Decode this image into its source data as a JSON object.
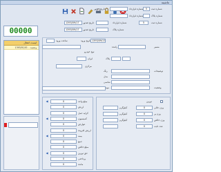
{
  "window": {
    "title": "ماشینه"
  },
  "toolbar": {
    "buttons": [
      {
        "name": "save-icon",
        "color": "#2d5fb0"
      },
      {
        "name": "delete-x-icon",
        "color": "#c0392b"
      },
      {
        "name": "new-document-icon",
        "color": "#3c7a3c"
      },
      {
        "name": "edit-pencil-icon",
        "color": "#c8a030"
      },
      {
        "name": "print-icon",
        "color": "#5a6a80"
      },
      {
        "name": "lock-icon",
        "color": "#c8a030"
      },
      {
        "name": "bottle-icon",
        "color": "#3c6fb0"
      },
      {
        "name": "close-icon",
        "color": "#d02020"
      }
    ]
  },
  "header": {
    "row1": {
      "serial_label": "شماره ثبت",
      "serial_value": "5",
      "contract_label": "شماره قرارداد",
      "contract_value": "",
      "issue_date_label": "تاریخ صدور",
      "issue_date_value": "1393/09/17"
    },
    "row2": {
      "plate_label": "شماره پلاک",
      "plate_value": "",
      "reg_date_label": "تاریخ صدور",
      "reg_date_value": "1393/09/17"
    }
  },
  "counter": {
    "value": "00000"
  },
  "sidebar_list": {
    "header": "لیست انتقال",
    "rows": [
      "1393/01/01 - وضعیت"
    ]
  },
  "vehicle": {
    "entry_date_label": "تاریخ ورود",
    "entry_date_value": "1393/09/17",
    "entry_hour_label": "ساعت ورود",
    "entry_hour_value": "",
    "driver_label": "راننده",
    "vehicle_type_label": "نوع خودرو",
    "plate_label": "پلاک",
    "iran_label": "ایران",
    "place_label": "مرکزی",
    "color_label": "رنگ",
    "model_label": "مدل",
    "chassis_label": "شاسی",
    "motor_label": "موتور",
    "route_label": "مسیر",
    "description_label": "توضیحات",
    "status_label": "وضعیت"
  },
  "fees": {
    "labels": [
      "مبلغ واحد",
      "ارزش",
      "کرایه حمل",
      "کمیسیون",
      "عوارض",
      "ارزش افزوده",
      "بیمه",
      "جمع",
      "مبلغ خالص",
      "حق توزین",
      "پرداختی",
      "مانده"
    ],
    "values": [
      "0",
      "0",
      "0",
      "0",
      "0",
      "0",
      "0",
      "0",
      "0",
      "0",
      "0",
      "0"
    ]
  },
  "weights": {
    "checkbox_label": "توزین",
    "rows": [
      {
        "label": "وزن خالی",
        "unit": "کیلوگرم",
        "value": "0"
      },
      {
        "label": "وزن پر",
        "unit": "کیلوگرم",
        "value": "0"
      },
      {
        "label": "وزن خالص",
        "unit": "کیلوگرم",
        "value": "0"
      },
      {
        "label": "عدد ثابت",
        "unit": "",
        "value": "0"
      }
    ]
  }
}
